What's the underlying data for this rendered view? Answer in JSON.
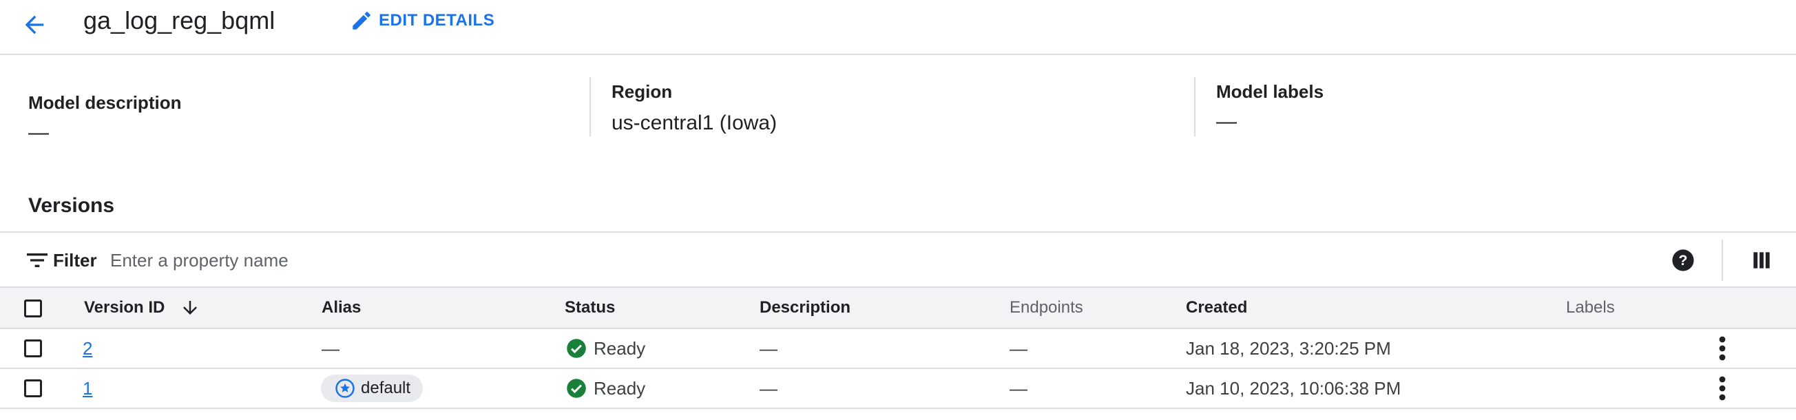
{
  "header": {
    "title": "ga_log_reg_bqml",
    "edit_label": "EDIT DETAILS",
    "back_icon": "arrow-back-icon",
    "edit_icon": "pencil-icon"
  },
  "details": {
    "description": {
      "label": "Model description",
      "value": "—"
    },
    "region": {
      "label": "Region",
      "value": "us-central1 (Iowa)"
    },
    "labels": {
      "label": "Model labels",
      "value": "—"
    }
  },
  "versions": {
    "title": "Versions",
    "filter": {
      "label": "Filter",
      "placeholder": "Enter a property name"
    },
    "columns": {
      "version_id": "Version ID",
      "alias": "Alias",
      "status": "Status",
      "description": "Description",
      "endpoints": "Endpoints",
      "created": "Created",
      "labels": "Labels"
    },
    "rows": [
      {
        "version_id": "2",
        "alias": "—",
        "status": "Ready",
        "description": "—",
        "endpoints": "—",
        "created": "Jan 18, 2023, 3:20:25 PM"
      },
      {
        "version_id": "1",
        "alias": "default",
        "status": "Ready",
        "description": "—",
        "endpoints": "—",
        "created": "Jan 10, 2023, 10:06:38 PM"
      }
    ]
  },
  "colors": {
    "accent": "#1a73e8",
    "success": "#188038",
    "divider": "#dadce0",
    "header_bg": "#f1f3f4"
  }
}
